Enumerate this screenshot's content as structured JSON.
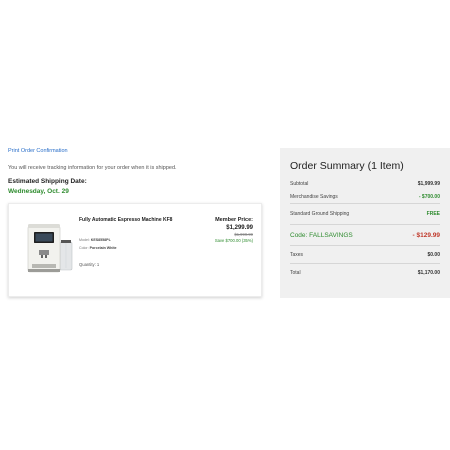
{
  "left": {
    "print_link": "Print Order Confirmation",
    "tracking_text": "You will receive tracking information for your order when it is shipped.",
    "ship_label": "Estimated Shipping Date:",
    "ship_date": "Wednesday, Oct. 29"
  },
  "item": {
    "title": "Fully Automatic Espresso Machine KF8",
    "model_label": "Model:",
    "model_value": "KES8558PL",
    "color_label": "Color:",
    "color_value": "Porcelain White",
    "quantity": "Quantity: 1",
    "member_price_label": "Member Price:",
    "member_price": "$1,299.99",
    "original_price": "$1,999.99",
    "savings": "Save $700.00 (35%)",
    "image_icon": "espresso-machine-icon"
  },
  "summary": {
    "title": "Order Summary (1 Item)",
    "rows": [
      {
        "label": "Subtotal",
        "value": "$1,999.99"
      },
      {
        "label": "Merchandise Savings",
        "value": "- $700.00"
      },
      {
        "label": "Standard Ground Shipping",
        "value": "FREE"
      },
      {
        "label": "Code: FALLSAVINGS",
        "value": "- $129.99"
      },
      {
        "label": "Taxes",
        "value": "$0.00"
      },
      {
        "label": "Total",
        "value": "$1,170.00"
      }
    ]
  },
  "colors": {
    "link": "#2a6fc9",
    "green": "#2e8b2e",
    "discount_red": "#c0392b",
    "summary_bg": "#f0f0f0"
  }
}
